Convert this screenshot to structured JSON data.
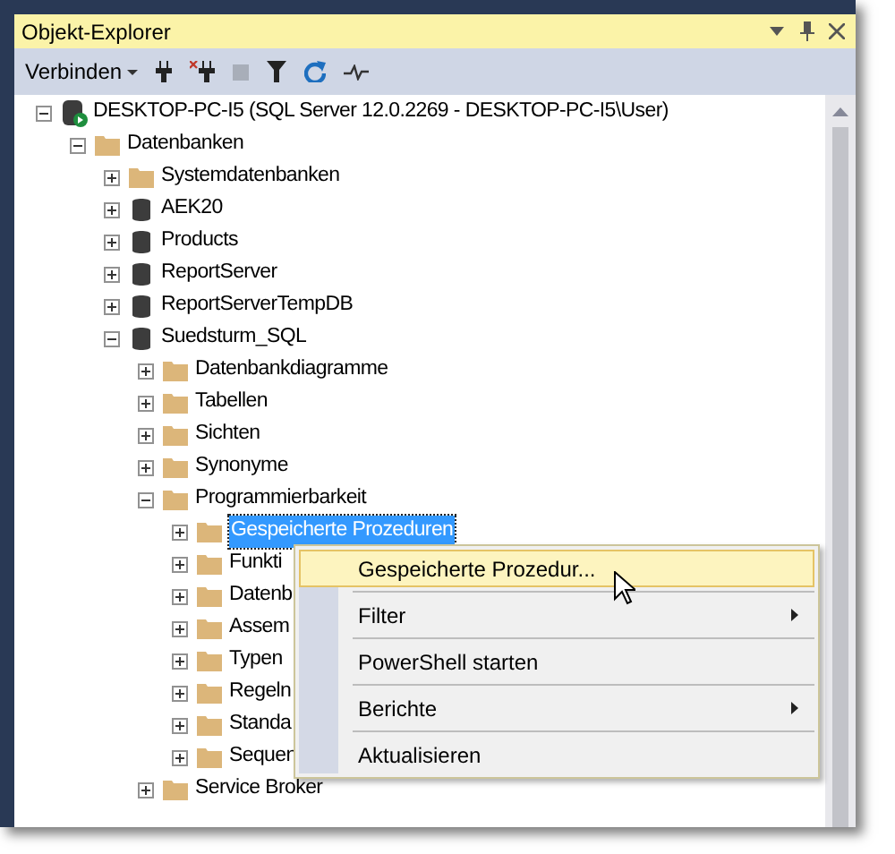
{
  "panel": {
    "title": "Objekt-Explorer"
  },
  "toolbar": {
    "connect_label": "Verbinden"
  },
  "tree": [
    {
      "kind": "server",
      "label": "DESKTOP-PC-I5 (SQL Server 12.0.2269 - DESKTOP-PC-I5\\User)",
      "expanded": true,
      "selected": false,
      "children": [
        {
          "kind": "folder",
          "label": "Datenbanken",
          "expanded": true,
          "selected": false,
          "children": [
            {
              "kind": "folder",
              "label": "Systemdatenbanken",
              "expanded": false,
              "selected": false
            },
            {
              "kind": "database",
              "label": "AEK20",
              "expanded": false,
              "selected": false
            },
            {
              "kind": "database",
              "label": "Products",
              "expanded": false,
              "selected": false
            },
            {
              "kind": "database",
              "label": "ReportServer",
              "expanded": false,
              "selected": false
            },
            {
              "kind": "database",
              "label": "ReportServerTempDB",
              "expanded": false,
              "selected": false
            },
            {
              "kind": "database",
              "label": "Suedsturm_SQL",
              "expanded": true,
              "selected": false,
              "children": [
                {
                  "kind": "folder",
                  "label": "Datenbankdiagramme",
                  "expanded": false,
                  "selected": false
                },
                {
                  "kind": "folder",
                  "label": "Tabellen",
                  "expanded": false,
                  "selected": false
                },
                {
                  "kind": "folder",
                  "label": "Sichten",
                  "expanded": false,
                  "selected": false
                },
                {
                  "kind": "folder",
                  "label": "Synonyme",
                  "expanded": false,
                  "selected": false
                },
                {
                  "kind": "folder",
                  "label": "Programmierbarkeit",
                  "expanded": true,
                  "selected": false,
                  "children": [
                    {
                      "kind": "folder",
                      "label": "Gespeicherte Prozeduren",
                      "expanded": false,
                      "selected": true
                    },
                    {
                      "kind": "folder",
                      "label": "Funkti",
                      "expanded": false,
                      "selected": false
                    },
                    {
                      "kind": "folder",
                      "label": "Datenb",
                      "expanded": false,
                      "selected": false
                    },
                    {
                      "kind": "folder",
                      "label": "Assem",
                      "expanded": false,
                      "selected": false
                    },
                    {
                      "kind": "folder",
                      "label": "Typen",
                      "expanded": false,
                      "selected": false
                    },
                    {
                      "kind": "folder",
                      "label": "Regeln",
                      "expanded": false,
                      "selected": false
                    },
                    {
                      "kind": "folder",
                      "label": "Standa",
                      "expanded": false,
                      "selected": false
                    },
                    {
                      "kind": "folder",
                      "label": "Sequen",
                      "expanded": false,
                      "selected": false
                    }
                  ]
                },
                {
                  "kind": "folder",
                  "label": "Service Broker",
                  "expanded": false,
                  "selected": false
                }
              ]
            }
          ]
        }
      ]
    }
  ],
  "context_menu": {
    "items": [
      {
        "label": "Gespeicherte Prozedur...",
        "highlighted": true,
        "submenu": false
      },
      {
        "label": "Filter",
        "highlighted": false,
        "submenu": true
      },
      {
        "label": "PowerShell starten",
        "highlighted": false,
        "submenu": false
      },
      {
        "label": "Berichte",
        "highlighted": false,
        "submenu": true
      },
      {
        "label": "Aktualisieren",
        "highlighted": false,
        "submenu": false
      }
    ]
  }
}
